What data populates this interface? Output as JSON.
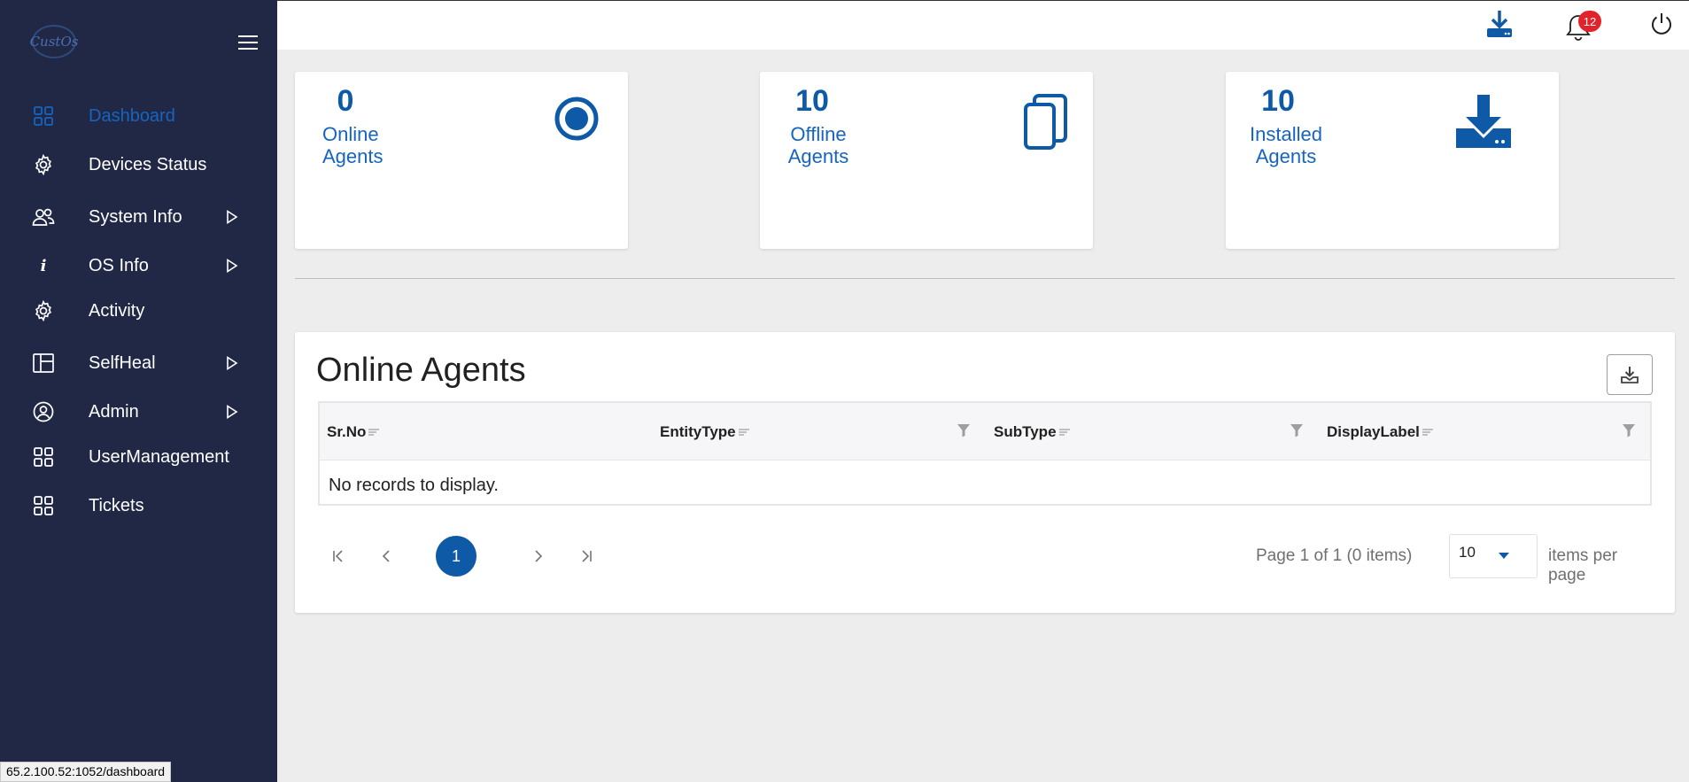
{
  "app": {
    "logo_text": "CustOs"
  },
  "sidebar": {
    "items": [
      {
        "label": "Dashboard",
        "icon": "grid-icon",
        "active": true,
        "has_submenu": false
      },
      {
        "label": "Devices Status",
        "icon": "gear-icon",
        "active": false,
        "has_submenu": false
      },
      {
        "label": "System Info",
        "icon": "users-icon",
        "active": false,
        "has_submenu": true
      },
      {
        "label": "OS Info",
        "icon": "info-icon",
        "active": false,
        "has_submenu": true
      },
      {
        "label": "Activity",
        "icon": "gear-icon",
        "active": false,
        "has_submenu": false
      },
      {
        "label": "SelfHeal",
        "icon": "layout-icon",
        "active": false,
        "has_submenu": true
      },
      {
        "label": "Admin",
        "icon": "user-circle-icon",
        "active": false,
        "has_submenu": true
      },
      {
        "label": "UserManagement",
        "icon": "grid-icon",
        "active": false,
        "has_submenu": false
      },
      {
        "label": "Tickets",
        "icon": "grid-icon",
        "active": false,
        "has_submenu": false
      }
    ]
  },
  "topbar": {
    "icons": [
      "download-icon",
      "bell-icon",
      "power-icon"
    ],
    "notification_count": "12"
  },
  "cards": [
    {
      "count": "0",
      "label_line1": "Online",
      "label_line2": "Agents",
      "icon": "radio-target-icon"
    },
    {
      "count": "10",
      "label_line1": "Offline",
      "label_line2": "Agents",
      "icon": "copy-pages-icon"
    },
    {
      "count": "10",
      "label_line1": "Installed",
      "label_line2": "Agents",
      "icon": "install-download-icon"
    }
  ],
  "panel": {
    "title": "Online Agents",
    "columns": [
      "Sr.No",
      "EntityType",
      "SubType",
      "DisplayLabel"
    ],
    "empty_text": "No records to display."
  },
  "pager": {
    "current_page": "1",
    "info": "Page 1 of 1 (0 items)",
    "page_size": "10",
    "items_per_page_label": "items per page"
  },
  "statusbar": {
    "url": "65.2.100.52:1052/dashboard"
  },
  "colors": {
    "sidebar_bg": "#202846",
    "accent": "#0f5aa6",
    "badge": "#e3232b",
    "page_bg": "#ededed"
  }
}
